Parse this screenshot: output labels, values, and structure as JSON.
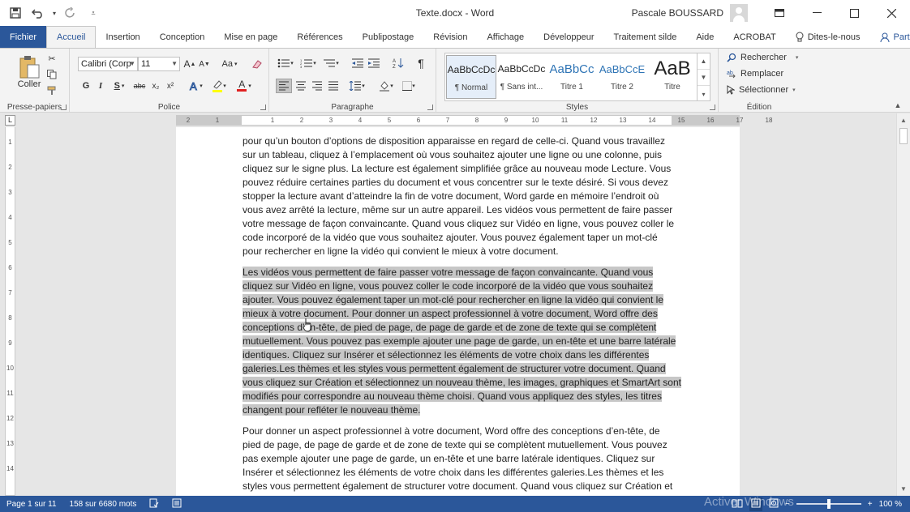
{
  "app": {
    "document_title": "Texte.docx - Word",
    "user_name": "Pascale BOUSSARD"
  },
  "quick_access": {
    "icons": [
      "save-icon",
      "undo-icon",
      "redo-icon",
      "customize-icon"
    ]
  },
  "window_controls": [
    "ribbon-display-icon",
    "minimize-icon",
    "maximize-icon",
    "close-icon"
  ],
  "tabs": [
    {
      "label": "Fichier"
    },
    {
      "label": "Accueil"
    },
    {
      "label": "Insertion"
    },
    {
      "label": "Conception"
    },
    {
      "label": "Mise en page"
    },
    {
      "label": "Références"
    },
    {
      "label": "Publipostage"
    },
    {
      "label": "Révision"
    },
    {
      "label": "Affichage"
    },
    {
      "label": "Développeur"
    },
    {
      "label": "Traitement silde"
    },
    {
      "label": "Aide"
    },
    {
      "label": "ACROBAT"
    }
  ],
  "tell_me": "Dites-le-nous",
  "share": "Partager",
  "ribbon": {
    "clipboard": {
      "label": "Presse-papiers",
      "paste": "Coller"
    },
    "font": {
      "label": "Police",
      "font_name": "Calibri (Corp",
      "font_size": "11",
      "grow": "A",
      "shrink": "A",
      "case": "Aa",
      "bold": "G",
      "italic": "I",
      "underline": "S",
      "strike": "abc",
      "subscript": "x₂",
      "superscript": "x²",
      "font_color_letter": "A"
    },
    "paragraph": {
      "label": "Paragraphe",
      "pilcrow": "¶"
    },
    "styles": {
      "label": "Styles",
      "items": [
        {
          "preview": "AaBbCcDc",
          "name": "¶ Normal"
        },
        {
          "preview": "AaBbCcDc",
          "name": "¶ Sans int..."
        },
        {
          "preview": "AaBbCc",
          "name": "Titre 1"
        },
        {
          "preview": "AaBbCcE",
          "name": "Titre 2"
        },
        {
          "preview": "AaB",
          "name": "Titre"
        }
      ]
    },
    "editing": {
      "label": "Édition",
      "find": "Rechercher",
      "replace": "Remplacer",
      "select": "Sélectionner"
    }
  },
  "ruler": {
    "h_ticks": [
      "2",
      "1",
      "1",
      "2",
      "3",
      "4",
      "5",
      "6",
      "7",
      "8",
      "9",
      "10",
      "11",
      "12",
      "13",
      "14",
      "15",
      "16",
      "17",
      "18"
    ],
    "v_ticks": [
      "1",
      "2",
      "3",
      "4",
      "5",
      "6",
      "7",
      "8",
      "9",
      "10",
      "11",
      "12",
      "13",
      "14"
    ]
  },
  "document": {
    "para1": [
      "pour qu’un bouton d’options de disposition apparaisse en regard de celle-ci. Quand vous travaillez",
      "sur un tableau, cliquez à l’emplacement où vous souhaitez ajouter une ligne ou une colonne, puis",
      "cliquez sur le signe plus. La lecture est également simplifiée grâce au nouveau mode Lecture. Vous",
      "pouvez réduire certaines parties du document et vous concentrer sur le texte désiré. Si vous devez",
      "stopper la lecture avant d’atteindre la fin de votre document, Word garde en mémoire l’endroit où",
      "vous avez arrêté la lecture, même sur un autre appareil. Les vidéos vous permettent de faire passer",
      "votre message de façon convaincante. Quand vous cliquez sur Vidéo en ligne, vous pouvez coller le",
      "code incorporé de la vidéo que vous souhaitez ajouter. Vous pouvez également taper un mot-clé",
      "pour rechercher en ligne la vidéo qui convient le mieux à votre document."
    ],
    "para2_selected": [
      "Les vidéos vous permettent de faire passer votre message de façon convaincante. Quand vous",
      "cliquez sur Vidéo en ligne, vous pouvez coller le code incorporé de la vidéo que vous souhaitez",
      "ajouter. Vous pouvez également taper un mot-clé pour rechercher en ligne la vidéo qui convient le",
      "mieux à votre document. Pour donner un aspect professionnel à votre document, Word offre des",
      "conceptions d’en-tête, de pied de page, de page de garde et de zone de texte qui se complètent",
      "mutuellement. Vous pouvez pas exemple ajouter une page de garde, un en-tête et une barre latérale",
      "identiques. Cliquez sur Insérer et sélectionnez les éléments de votre choix dans les différentes",
      "galeries.Les thèmes et les styles vous permettent également de structurer votre document. Quand",
      "vous cliquez sur Création et sélectionnez un nouveau thème, les images, graphiques et SmartArt sont",
      "modifiés pour correspondre au nouveau thème choisi. Quand vous appliquez des styles, les titres",
      "changent pour refléter le nouveau thème."
    ],
    "para3": [
      "Pour donner un aspect professionnel à votre document, Word offre des conceptions d’en-tête, de",
      "pied de page, de page de garde et de zone de texte qui se complètent mutuellement. Vous pouvez",
      "pas exemple ajouter une page de garde, un en-tête et une barre latérale identiques. Cliquez sur",
      "Insérer et sélectionnez les éléments de votre choix dans les différentes galeries.Les thèmes et les",
      "styles vous permettent également de structurer votre document. Quand vous cliquez sur Création et"
    ]
  },
  "status": {
    "page": "Page 1 sur 11",
    "words": "158 sur 6680 mots",
    "zoom": "100 %",
    "watermark": "Activer Windows"
  },
  "colors": {
    "accent": "#2b579a",
    "selection": "#c7c7c7"
  }
}
